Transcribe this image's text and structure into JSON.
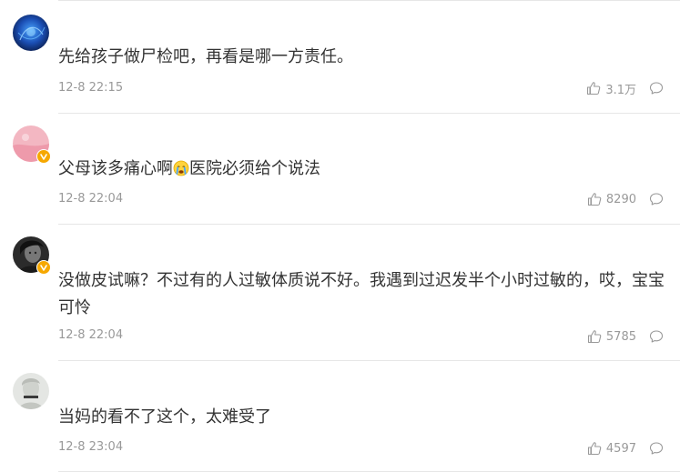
{
  "comments": [
    {
      "text": "先给孩子做尸检吧，再看是哪一方责任。",
      "time": "12-8 22:15",
      "likes": "3.1万",
      "verified": false,
      "avatar": "blue-abstract-avatar"
    },
    {
      "text_before": "父母该多痛心啊",
      "emoji": "crying-face-emoji",
      "text_after": "医院必须给个说法",
      "time": "12-8 22:04",
      "likes": "8290",
      "verified": true,
      "avatar": "pink-avatar"
    },
    {
      "text": "没做皮试嘛？不过有的人过敏体质说不好。我遇到过迟发半个小时过敏的，哎，宝宝可怜",
      "time": "12-8 22:04",
      "likes": "5785",
      "verified": true,
      "avatar": "dark-portrait-avatar"
    },
    {
      "text": "当妈的看不了这个，太难受了",
      "time": "12-8 23:04",
      "likes": "4597",
      "verified": false,
      "avatar": "statue-avatar"
    }
  ],
  "colors": {
    "text": "#333333",
    "meta": "#999999",
    "divider": "#e6e6e6",
    "badge": "#f6a800"
  },
  "icons": [
    "thumbs-up-icon",
    "comment-bubble-icon",
    "verified-badge-icon"
  ]
}
